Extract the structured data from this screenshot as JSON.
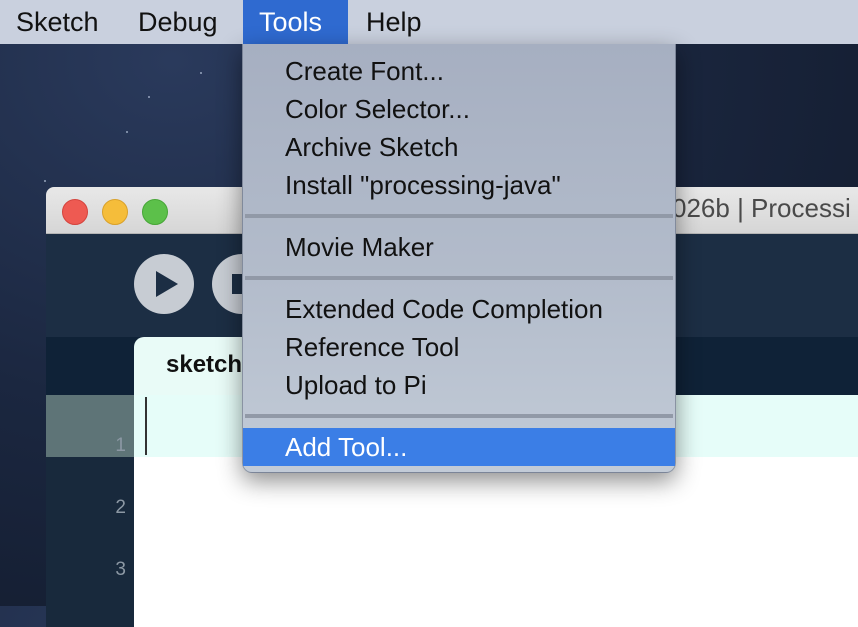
{
  "menubar": {
    "items": [
      {
        "label": "Sketch"
      },
      {
        "label": "Debug"
      },
      {
        "label": "Tools"
      },
      {
        "label": "Help"
      }
    ],
    "active": "Tools"
  },
  "tools_menu": {
    "items": [
      "Create Font...",
      "Color Selector...",
      "Archive Sketch",
      "Install \"processing-java\"",
      "Movie Maker",
      "Extended Code Completion",
      "Reference Tool",
      "Upload to Pi",
      "Add Tool..."
    ],
    "highlighted": "Add Tool..."
  },
  "window": {
    "title_visible": "026b | Processi",
    "tab_label": "sketch",
    "line_numbers": [
      "1",
      "2",
      "3"
    ]
  },
  "colors": {
    "menu_highlight": "#3b7ee6",
    "active_menu": "#2f6ad0",
    "editor_current_line": "#e6fdf9"
  }
}
